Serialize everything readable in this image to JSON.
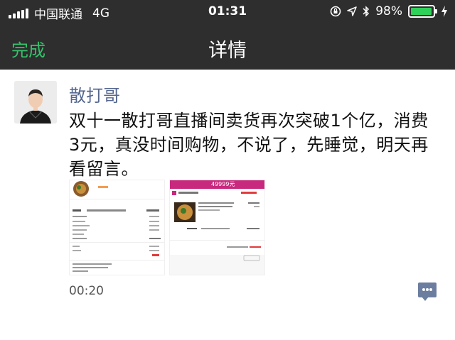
{
  "status_bar": {
    "carrier": "中国联通",
    "network": "4G",
    "time": "01:31",
    "battery": "98%",
    "battery_level": 0.98
  },
  "nav": {
    "done_label": "完成",
    "title": "详情"
  },
  "post": {
    "author": "散打哥",
    "text": "双十一散打哥直播间卖货再次突破1个亿，消费3元，真没时间购物，不说了，先睡觉，明天再看留言。",
    "time": "00:20"
  },
  "images": {
    "thumb2_banner": "49999元"
  },
  "colors": {
    "bar_bg": "#2e2e2e",
    "accent_green": "#36c26b",
    "author_blue": "#56678f"
  }
}
